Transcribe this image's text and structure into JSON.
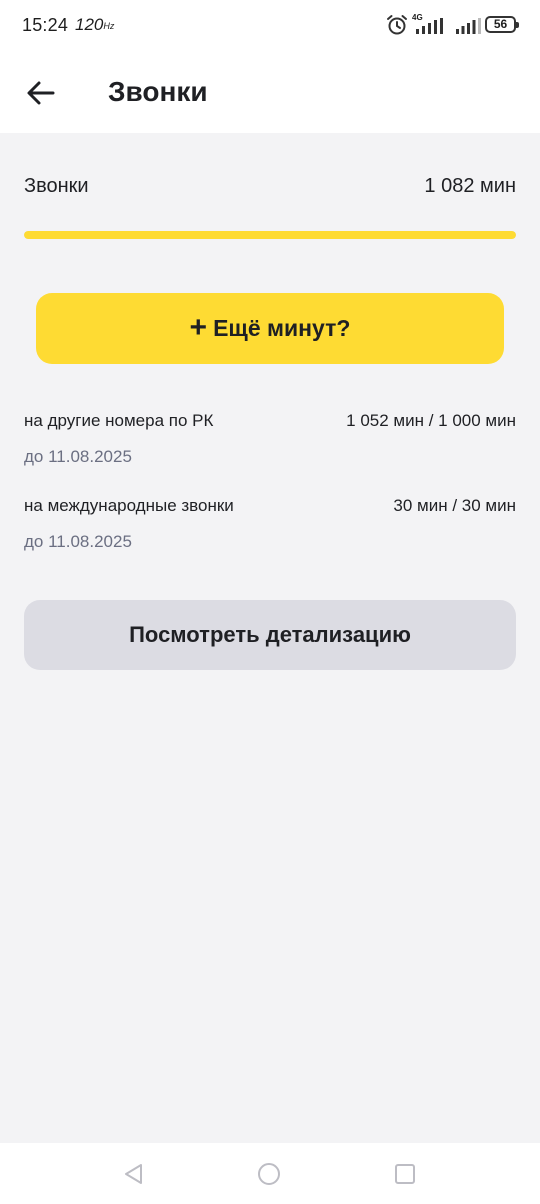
{
  "status_bar": {
    "time": "15:24",
    "refresh_rate": "120",
    "refresh_unit": "Hz",
    "network": "4G",
    "battery": "56"
  },
  "header": {
    "title": "Звонки"
  },
  "summary": {
    "label": "Звонки",
    "value": "1 082 мин",
    "remaining_fraction": 1.0
  },
  "more_button": {
    "plus": "+",
    "label": "Ещё минут?"
  },
  "packages": [
    {
      "name": "на другие номера по РК",
      "usage": "1 052 мин / 1 000 мин",
      "expiry": "до 11.08.2025"
    },
    {
      "name": "на международные звонки",
      "usage": "30 мин / 30 мин",
      "expiry": "до 11.08.2025"
    }
  ],
  "details_button": {
    "label": "Посмотреть детализацию"
  },
  "colors": {
    "accent": "#fedb33",
    "secondary_button": "#dcdce3",
    "background": "#f3f3f5",
    "muted_text": "#6b6f82"
  },
  "icons": {
    "back": "arrow-left-icon",
    "alarm": "alarm-clock-icon",
    "signal": "signal-bars-icon",
    "battery": "battery-icon",
    "nav_back": "triangle-back-icon",
    "nav_home": "circle-home-icon",
    "nav_recents": "square-recents-icon"
  }
}
